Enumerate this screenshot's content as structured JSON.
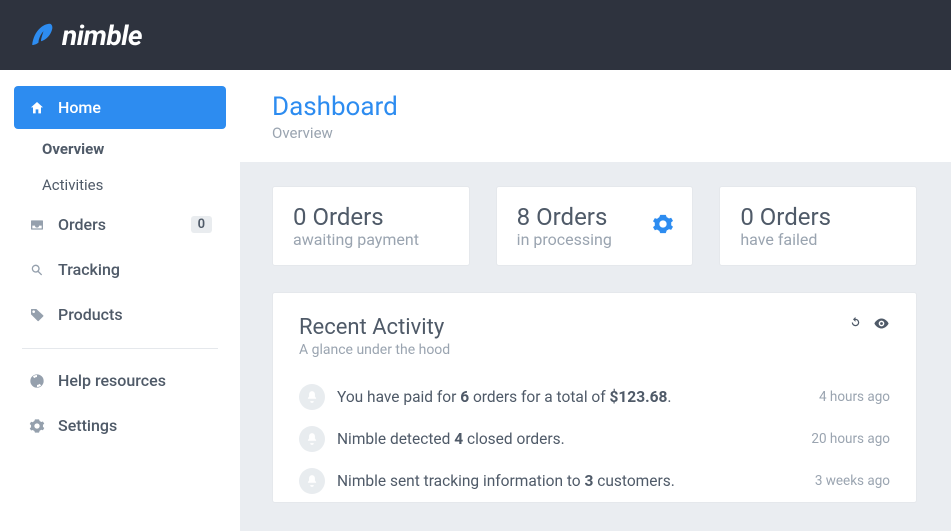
{
  "brand": {
    "name": "nimble"
  },
  "sidebar": {
    "items": [
      {
        "label": "Home",
        "icon": "home",
        "active": true,
        "sub": [
          {
            "label": "Overview",
            "active": true
          },
          {
            "label": "Activities",
            "active": false
          }
        ]
      },
      {
        "label": "Orders",
        "icon": "inbox",
        "badge": "0"
      },
      {
        "label": "Tracking",
        "icon": "search"
      },
      {
        "label": "Products",
        "icon": "tag"
      },
      null,
      {
        "label": "Help resources",
        "icon": "life-ring"
      },
      {
        "label": "Settings",
        "icon": "gear"
      }
    ]
  },
  "page": {
    "title": "Dashboard",
    "subtitle": "Overview"
  },
  "stats": [
    {
      "count": "0",
      "unit": "Orders",
      "label": "awaiting payment",
      "icon": null
    },
    {
      "count": "8",
      "unit": "Orders",
      "label": "in processing",
      "icon": "gear"
    },
    {
      "count": "0",
      "unit": "Orders",
      "label": "have failed",
      "icon": null
    }
  ],
  "activity": {
    "title": "Recent Activity",
    "subtitle": "A glance under the hood",
    "items": [
      {
        "pre": "You have paid for ",
        "b1": "6",
        "mid": " orders for a total of ",
        "b2": "$123.68",
        "post": ".",
        "time": "4 hours ago"
      },
      {
        "pre": "Nimble detected ",
        "b1": "4",
        "mid": " closed orders.",
        "b2": "",
        "post": "",
        "time": "20 hours ago"
      },
      {
        "pre": "Nimble sent tracking information to ",
        "b1": "3",
        "mid": " customers.",
        "b2": "",
        "post": "",
        "time": "3 weeks ago"
      }
    ]
  }
}
